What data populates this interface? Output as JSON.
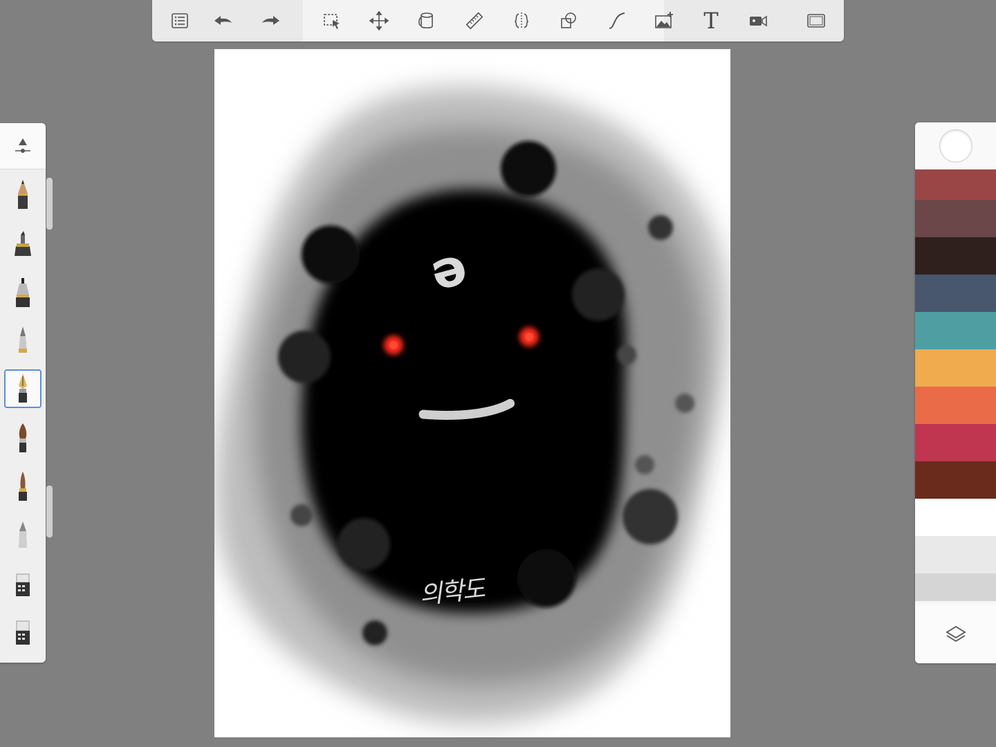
{
  "toolbar": {
    "text_tool_glyph": "T",
    "items": [
      {
        "name": "list-icon"
      },
      {
        "name": "undo-icon"
      },
      {
        "name": "redo-icon"
      },
      {
        "name": "selection-icon"
      },
      {
        "name": "transform-icon"
      },
      {
        "name": "paint-bucket-icon"
      },
      {
        "name": "ruler-icon"
      },
      {
        "name": "symmetry-icon"
      },
      {
        "name": "shapes-icon"
      },
      {
        "name": "curve-icon"
      },
      {
        "name": "image-add-icon"
      },
      {
        "name": "text-icon"
      },
      {
        "name": "record-video-icon"
      },
      {
        "name": "fullscreen-icon"
      }
    ]
  },
  "canvas": {
    "signature": "의학도",
    "symbol": "ə"
  },
  "brushes": [
    {
      "name": "pencil-brush",
      "selected": false
    },
    {
      "name": "marker-brush",
      "selected": false
    },
    {
      "name": "ink-pen-brush",
      "selected": false
    },
    {
      "name": "ballpoint-brush",
      "selected": false
    },
    {
      "name": "fountain-pen-brush",
      "selected": true
    },
    {
      "name": "paint-brush",
      "selected": false
    },
    {
      "name": "fine-brush",
      "selected": false
    },
    {
      "name": "airbrush-brush",
      "selected": false
    },
    {
      "name": "soft-eraser-brush",
      "selected": false
    },
    {
      "name": "hard-eraser-brush",
      "selected": false
    }
  ],
  "colors": {
    "current": "#ffffff",
    "swatches": [
      "#9b4646",
      "#6b474a",
      "#2f201e",
      "#48566e",
      "#4f9ea2",
      "#f0ab4f",
      "#ea6b48",
      "#c0354f",
      "#6a2b1d",
      "#ffffff",
      "#e9e9e9",
      "#d5d5d5"
    ]
  }
}
